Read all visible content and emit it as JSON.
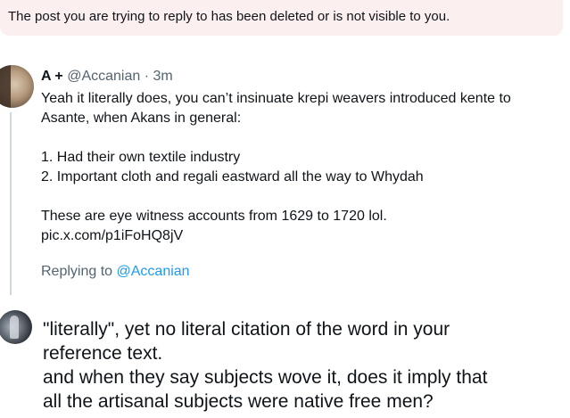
{
  "notice": {
    "text": "The post you are trying to reply to has been deleted or is not visible to you."
  },
  "post": {
    "name": "A +",
    "handle": "@Accanian",
    "separator": "·",
    "time": "3m",
    "lines": [
      "Yeah it literally does, you can’t insinuate krepi weavers introduced kente to",
      "Asante, when Akans in general:",
      "1. Had their own textile industry",
      "2. Important cloth and regali eastward all the way to Whydah",
      "These are eye witness accounts from 1629 to 1720 lol.",
      "pic.x.com/p1iFoHQ8jV"
    ],
    "replying_prefix": "Replying to",
    "replying_mention": "@Accanian"
  },
  "reply": {
    "lines": [
      "\"literally\", yet no literal citation of the word in your",
      "reference text.",
      "and when they say subjects wove it, does it imply that",
      "all the artisanal subjects were native free men?"
    ]
  }
}
